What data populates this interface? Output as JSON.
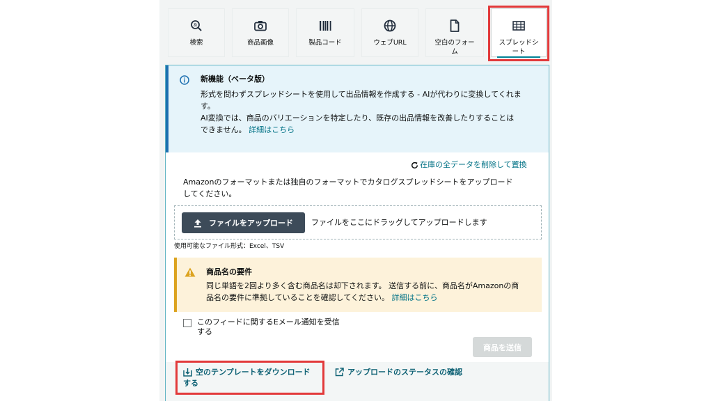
{
  "tabs": [
    {
      "label": "検索",
      "icon": "search-icon"
    },
    {
      "label": "商品画像",
      "icon": "camera-icon"
    },
    {
      "label": "製品コード",
      "icon": "barcode-icon"
    },
    {
      "label": "ウェブURL",
      "icon": "globe-icon"
    },
    {
      "label": "空白のフォーム",
      "icon": "blank-document-icon"
    },
    {
      "label": "スプレッドシート",
      "icon": "spreadsheet-icon"
    }
  ],
  "info": {
    "title": "新機能（ベータ版）",
    "line1": "形式を問わずスプレッドシートを使用して出品情報を作成する - AIが代わりに変換してくれま",
    "line1b": "す。",
    "line2": "AI変換では、商品のバリエーションを特定したり、既存の出品情報を改善したりすることは",
    "line3": "できません。",
    "details_link": "詳細はこちら"
  },
  "replace_link": "在庫の全データを削除して置換",
  "instruction": {
    "line1": "Amazonのフォーマットまたは独自のフォーマットでカタログスプレッドシートをアップロード",
    "line2": "してください。"
  },
  "upload": {
    "button_label": "ファイルをアップロード",
    "drop_hint": "ファイルをここにドラッグしてアップロードします",
    "formats": "使用可能なファイル形式：Excel、TSV"
  },
  "warning": {
    "title": "商品名の要件",
    "line1": "同じ単語を2回より多く含む商品名は却下されます。 送信する前に、商品名がAmazonの商",
    "line2": "品名の要件に準拠していることを確認してください。",
    "details_link": "詳細はこちら"
  },
  "email_checkbox": {
    "line1": "このフィードに関するEメール通知を受信",
    "line2": "する",
    "checked": false
  },
  "send_button": "商品を送信",
  "bottom": {
    "template_line1": "空のテンプレートをダウンロード",
    "template_line2": "する",
    "status_link": "アップロードのステータスの確認"
  },
  "colors": {
    "accent": "#007185",
    "highlight": "#e2393a",
    "info_bg": "#e6f4fa",
    "warning_bg": "#fdf2da"
  }
}
